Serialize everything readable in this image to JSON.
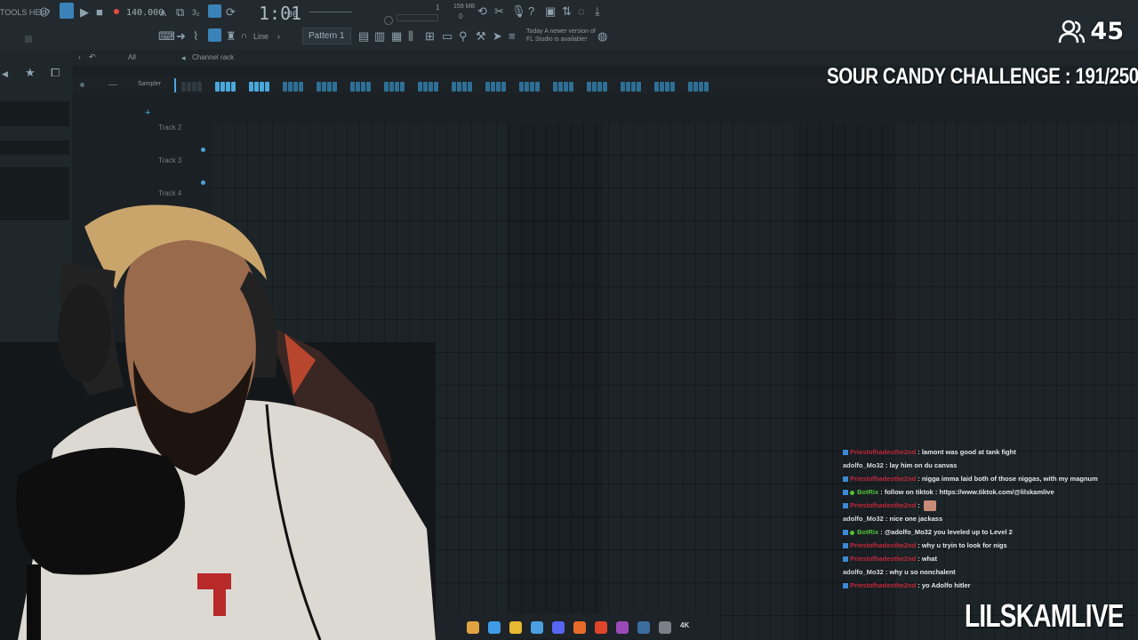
{
  "toolbar": {
    "menu_label": "TOOLS HELP",
    "tempo": "140.000",
    "time": "1:01",
    "time_sub": "00",
    "memory": "159 MB",
    "memory_sub": "0",
    "cpu_value": "1",
    "snap_mode": "Line",
    "pattern": "Pattern 1",
    "update_notice": "Today  A newer version of FL Studio is available!"
  },
  "channel_rack": {
    "filter": "All",
    "title": "Channel rack",
    "channel_name": "Sampler"
  },
  "playlist": {
    "tracks": [
      "Track 2",
      "Track 3",
      "Track 4"
    ]
  },
  "stream": {
    "viewer_count": "45",
    "challenge_text": "SOUR CANDY CHALLENGE : 191/250",
    "channel_name": "LILSKAMLIVE"
  },
  "chat": [
    {
      "user": "Priestofhadesthe2nd",
      "text": ": lamont was good at tank fight",
      "color": "#c0283a",
      "badge": "mod"
    },
    {
      "user": "adolfo_Mo32",
      "text": ": lay him on du canvas",
      "color": "#d8d8d8",
      "badge": ""
    },
    {
      "user": "Priestofhadesthe2nd",
      "text": ": nigga imma laid both of those niggas, with my magnum",
      "color": "#c0283a",
      "badge": "mod"
    },
    {
      "user": "BotRix",
      "text": ": follow on tiktok : https://www.tiktok.com/@lilskamlive",
      "color": "#52c23a",
      "badge": "bot"
    },
    {
      "user": "Priestofhadesthe2nd",
      "text": ":",
      "color": "#c0283a",
      "badge": "mod",
      "emote": true
    },
    {
      "user": "adolfo_Mo32",
      "text": ": nice one jackass",
      "color": "#d8d8d8",
      "badge": ""
    },
    {
      "user": "BotRix",
      "text": ": @adolfo_Mo32 you leveled up to Level 2",
      "color": "#52c23a",
      "badge": "bot"
    },
    {
      "user": "Priestofhadesthe2nd",
      "text": ": why u tryin to look for nigs",
      "color": "#c0283a",
      "badge": "mod"
    },
    {
      "user": "Priestofhadesthe2nd",
      "text": ": what",
      "color": "#c0283a",
      "badge": "mod"
    },
    {
      "user": "adolfo_Mo32",
      "text": ": why u so nonchalent",
      "color": "#d8d8d8",
      "badge": ""
    },
    {
      "user": "Priestofhadesthe2nd",
      "text": ": yo Adolfo hitler",
      "color": "#c0283a",
      "badge": "mod"
    }
  ],
  "taskbar": {
    "icons": [
      "game-icon",
      "copilot-icon",
      "folder-icon",
      "store-icon",
      "discord-icon",
      "fl-studio-icon",
      "brave-icon",
      "obs-icon",
      "steam-icon",
      "controller-icon",
      "4k-icon"
    ],
    "icon_labels": {
      "fourk": "4K"
    }
  },
  "colors": {
    "accent": "#4ba8dc",
    "background": "#1b2024"
  }
}
